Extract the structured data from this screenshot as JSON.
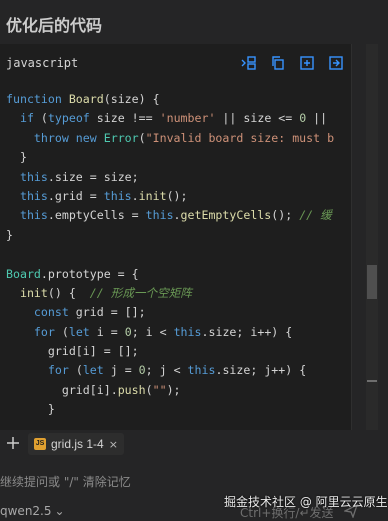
{
  "heading": "优化后的代码",
  "code_block": {
    "language": "javascript",
    "toolbar_icons": [
      "insert-at-cursor-icon",
      "copy-icon",
      "new-file-icon",
      "apply-to-file-icon"
    ],
    "lines": [
      [
        {
          "t": "kw",
          "v": "function "
        },
        {
          "t": "fn",
          "v": "Board"
        },
        {
          "t": "plain",
          "v": "(size) {"
        }
      ],
      [
        {
          "t": "plain",
          "v": "  "
        },
        {
          "t": "kw",
          "v": "if"
        },
        {
          "t": "plain",
          "v": " ("
        },
        {
          "t": "kw",
          "v": "typeof"
        },
        {
          "t": "plain",
          "v": " size !== "
        },
        {
          "t": "str",
          "v": "'number'"
        },
        {
          "t": "plain",
          "v": " || size <= "
        },
        {
          "t": "num",
          "v": "0"
        },
        {
          "t": "plain",
          "v": " ||"
        }
      ],
      [
        {
          "t": "plain",
          "v": "    "
        },
        {
          "t": "kw",
          "v": "throw new "
        },
        {
          "t": "cls",
          "v": "Error"
        },
        {
          "t": "plain",
          "v": "("
        },
        {
          "t": "str",
          "v": "\"Invalid board size: must b"
        }
      ],
      [
        {
          "t": "plain",
          "v": "  }"
        }
      ],
      [
        {
          "t": "plain",
          "v": "  "
        },
        {
          "t": "kw",
          "v": "this"
        },
        {
          "t": "plain",
          "v": ".size = size;"
        }
      ],
      [
        {
          "t": "plain",
          "v": "  "
        },
        {
          "t": "kw",
          "v": "this"
        },
        {
          "t": "plain",
          "v": ".grid = "
        },
        {
          "t": "kw",
          "v": "this"
        },
        {
          "t": "plain",
          "v": "."
        },
        {
          "t": "fn",
          "v": "init"
        },
        {
          "t": "plain",
          "v": "();"
        }
      ],
      [
        {
          "t": "plain",
          "v": "  "
        },
        {
          "t": "kw",
          "v": "this"
        },
        {
          "t": "plain",
          "v": ".emptyCells = "
        },
        {
          "t": "kw",
          "v": "this"
        },
        {
          "t": "plain",
          "v": "."
        },
        {
          "t": "fn",
          "v": "getEmptyCells"
        },
        {
          "t": "plain",
          "v": "(); "
        },
        {
          "t": "cmt",
          "v": "// 缓"
        }
      ],
      [
        {
          "t": "plain",
          "v": "}"
        }
      ],
      [
        {
          "t": "plain",
          "v": ""
        }
      ],
      [
        {
          "t": "cls",
          "v": "Board"
        },
        {
          "t": "plain",
          "v": ".prototype = {"
        }
      ],
      [
        {
          "t": "plain",
          "v": "  "
        },
        {
          "t": "fn",
          "v": "init"
        },
        {
          "t": "plain",
          "v": "() {  "
        },
        {
          "t": "cmt",
          "v": "// 形成一个空矩阵"
        }
      ],
      [
        {
          "t": "plain",
          "v": "    "
        },
        {
          "t": "kw",
          "v": "const"
        },
        {
          "t": "plain",
          "v": " grid = [];"
        }
      ],
      [
        {
          "t": "plain",
          "v": "    "
        },
        {
          "t": "kw",
          "v": "for"
        },
        {
          "t": "plain",
          "v": " ("
        },
        {
          "t": "kw",
          "v": "let"
        },
        {
          "t": "plain",
          "v": " i = "
        },
        {
          "t": "num",
          "v": "0"
        },
        {
          "t": "plain",
          "v": "; i < "
        },
        {
          "t": "kw",
          "v": "this"
        },
        {
          "t": "plain",
          "v": ".size; i++) {"
        }
      ],
      [
        {
          "t": "plain",
          "v": "      grid[i] = [];"
        }
      ],
      [
        {
          "t": "plain",
          "v": "      "
        },
        {
          "t": "kw",
          "v": "for"
        },
        {
          "t": "plain",
          "v": " ("
        },
        {
          "t": "kw",
          "v": "let"
        },
        {
          "t": "plain",
          "v": " j = "
        },
        {
          "t": "num",
          "v": "0"
        },
        {
          "t": "plain",
          "v": "; j < "
        },
        {
          "t": "kw",
          "v": "this"
        },
        {
          "t": "plain",
          "v": ".size; j++) {"
        }
      ],
      [
        {
          "t": "plain",
          "v": "        grid[i]."
        },
        {
          "t": "fn",
          "v": "push"
        },
        {
          "t": "plain",
          "v": "("
        },
        {
          "t": "str",
          "v": "\"\""
        },
        {
          "t": "plain",
          "v": ");"
        }
      ],
      [
        {
          "t": "plain",
          "v": "      }"
        }
      ]
    ]
  },
  "attachments": {
    "add_icon": "plus-icon",
    "file_chip": {
      "icon": "js-file-icon",
      "icon_text": "JS",
      "label": "grid.js 1-4",
      "close": "×"
    }
  },
  "input": {
    "placeholder": "继续提问或 \"/\" 清除记忆"
  },
  "footer": {
    "model": "qwen2.5",
    "model_chevron": "⌄",
    "shortcut_hint": "Ctrl+换行/↵发送",
    "send_icon": "send-icon",
    "watermark": "掘金技术社区 @ 阿里云云原生"
  }
}
